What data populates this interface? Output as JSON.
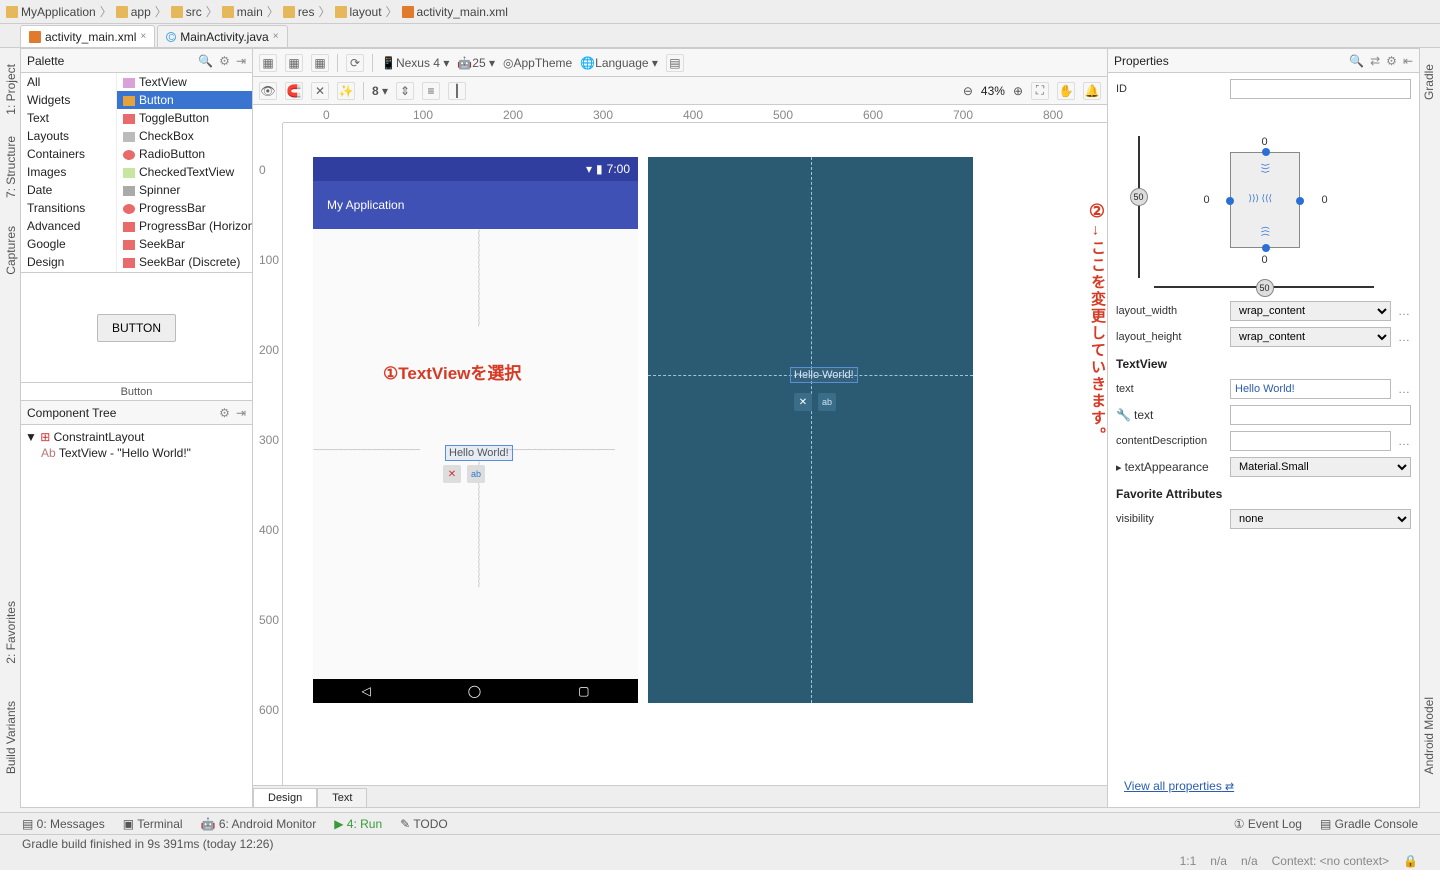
{
  "breadcrumb": [
    "MyApplication",
    "app",
    "src",
    "main",
    "res",
    "layout",
    "activity_main.xml"
  ],
  "tabs": [
    {
      "label": "activity_main.xml",
      "active": true
    },
    {
      "label": "MainActivity.java",
      "active": false
    }
  ],
  "sideTabs": {
    "leftTop1": "1: Project",
    "leftTop2": "7: Structure",
    "leftBottom1": "Captures",
    "leftBottom2": "2: Favorites",
    "leftBottom3": "Build Variants",
    "rightTop": "Gradle",
    "rightBottom": "Android Model"
  },
  "palette": {
    "title": "Palette",
    "categories": [
      "All",
      "Widgets",
      "Text",
      "Layouts",
      "Containers",
      "Images",
      "Date",
      "Transitions",
      "Advanced",
      "Google",
      "Design"
    ],
    "widgets": [
      "TextView",
      "Button",
      "ToggleButton",
      "CheckBox",
      "RadioButton",
      "CheckedTextView",
      "Spinner",
      "ProgressBar",
      "ProgressBar (Horizontal)",
      "SeekBar",
      "SeekBar (Discrete)"
    ],
    "selected": "Button",
    "previewCaption": "Button",
    "previewButton": "BUTTON"
  },
  "componentTree": {
    "title": "Component Tree",
    "root": "ConstraintLayout",
    "child": "TextView - \"Hello World!\""
  },
  "toolbar": {
    "device": "Nexus 4",
    "api": "25",
    "theme": "AppTheme",
    "lang": "Language",
    "zoom": "43%",
    "magic": "8"
  },
  "phone": {
    "time": "7:00",
    "appTitle": "My Application",
    "hello": "Hello World!"
  },
  "designTabs": {
    "design": "Design",
    "text": "Text"
  },
  "annotations": {
    "a1": "①TextViewを選択",
    "a2num": "②",
    "a2": "→ここを変更していきます。"
  },
  "properties": {
    "title": "Properties",
    "idLabel": "ID",
    "idValue": "",
    "constraintNums": {
      "top": "0",
      "left": "0",
      "right": "0",
      "bottom": "0",
      "sliderL": "50",
      "sliderB": "50"
    },
    "layout_width_label": "layout_width",
    "layout_width": "wrap_content",
    "layout_height_label": "layout_height",
    "layout_height": "wrap_content",
    "section": "TextView",
    "text_label": "text",
    "text": "Hello World!",
    "text2_label": "text",
    "text2": "",
    "contentDescription_label": "contentDescription",
    "contentDescription": "",
    "textAppearance_label": "textAppearance",
    "textAppearance": "Material.Small",
    "favSection": "Favorite Attributes",
    "visibility_label": "visibility",
    "visibility": "none",
    "viewAll": "View all properties"
  },
  "bottomTools": {
    "messages": "0: Messages",
    "terminal": "Terminal",
    "monitor": "6: Android Monitor",
    "run": "4: Run",
    "todo": "TODO",
    "eventlog": "Event Log",
    "gradlec": "Gradle Console"
  },
  "status": {
    "msg": "Gradle build finished in 9s 391ms (today 12:26)",
    "pos": "1:1",
    "enc": "n/a",
    "le": "n/a",
    "ctx": "Context: <no context>"
  }
}
